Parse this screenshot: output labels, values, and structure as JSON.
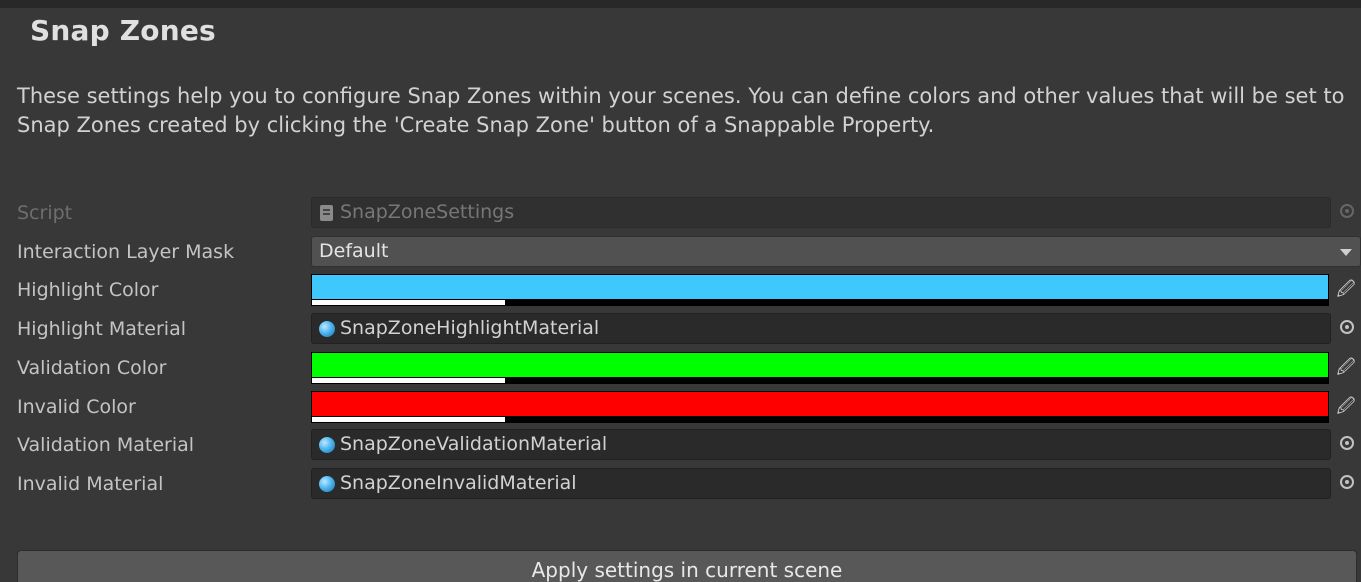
{
  "panel": {
    "title": "Snap Zones",
    "description": "These settings help you to configure Snap Zones within your scenes. You can define colors and other values that will be set to Snap Zones created by clicking the 'Create Snap Zone' button of a Snappable Property."
  },
  "fields": {
    "script": {
      "label": "Script",
      "value": "SnapZoneSettings",
      "icon": "script-file-icon"
    },
    "interaction_layer_mask": {
      "label": "Interaction Layer Mask",
      "value": "Default"
    },
    "highlight_color": {
      "label": "Highlight Color",
      "color": "#3fc8fb",
      "alpha": 0.19
    },
    "highlight_material": {
      "label": "Highlight Material",
      "value": "SnapZoneHighlightMaterial",
      "icon": "material-icon"
    },
    "validation_color": {
      "label": "Validation Color",
      "color": "#00ff00",
      "alpha": 0.19
    },
    "invalid_color": {
      "label": "Invalid Color",
      "color": "#ff0000",
      "alpha": 0.19
    },
    "validation_material": {
      "label": "Validation Material",
      "value": "SnapZoneValidationMaterial",
      "icon": "material-icon"
    },
    "invalid_material": {
      "label": "Invalid Material",
      "value": "SnapZoneInvalidMaterial",
      "icon": "material-icon"
    }
  },
  "actions": {
    "apply_label": "Apply settings in current scene"
  },
  "colors": {
    "background": "#383838",
    "field_background": "#2a2a2a",
    "dropdown_background": "#515151",
    "button_background": "#585858"
  }
}
